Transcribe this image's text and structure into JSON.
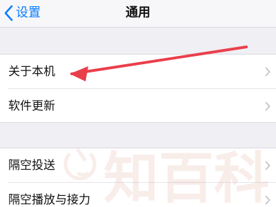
{
  "nav": {
    "back_label": "设置",
    "title": "通用"
  },
  "groups": [
    {
      "items": [
        {
          "label": "关于本机"
        },
        {
          "label": "软件更新"
        }
      ]
    },
    {
      "items": [
        {
          "label": "隔空投送"
        },
        {
          "label": "隔空播放与接力"
        }
      ]
    }
  ],
  "annotation": {
    "arrow_color": "#ea3f4b"
  },
  "watermark": {
    "brand": "知百科",
    "color": "#d9a08a"
  },
  "colors": {
    "accent": "#0a7cff",
    "background": "#efeff4",
    "card": "#ffffff",
    "separator": "#e3e3e8",
    "chevron": "#c4c4c9"
  }
}
